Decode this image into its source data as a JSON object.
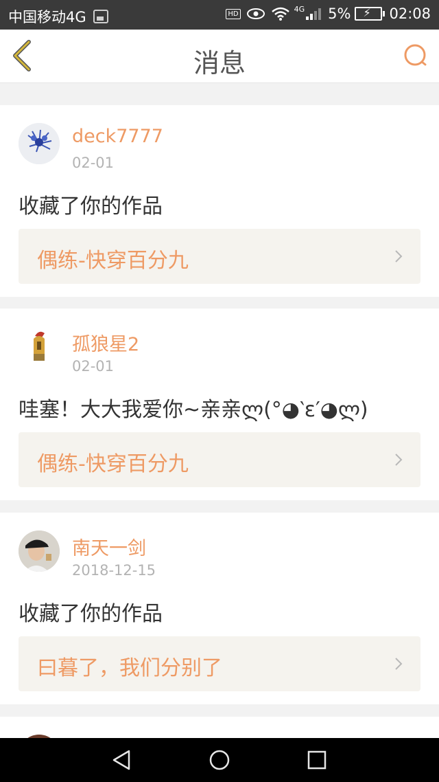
{
  "status_bar": {
    "carrier": "中国移动4G",
    "hd": "HD",
    "network": "4G",
    "battery_percent": "5%",
    "time": "02:08"
  },
  "header": {
    "title": "消息",
    "back_icon": "chevron-left-icon",
    "search_icon": "search-icon"
  },
  "colors": {
    "accent": "#ee9a64",
    "back_icon": "#d4b73a",
    "link_bg": "#f5f3ee"
  },
  "messages": [
    {
      "username": "deck7777",
      "date": "02-01",
      "content": "收藏了你的作品",
      "work_title": "偶练-快穿百分九"
    },
    {
      "username": "孤狼星2",
      "date": "02-01",
      "content": "哇塞！大大我爱你~亲亲ლ(°◕‵ε′◕ლ)",
      "work_title": "偶练-快穿百分九"
    },
    {
      "username": "南天一剑",
      "date": "2018-12-15",
      "content": "收藏了你的作品",
      "work_title": "曰暮了，我们分别了"
    }
  ]
}
